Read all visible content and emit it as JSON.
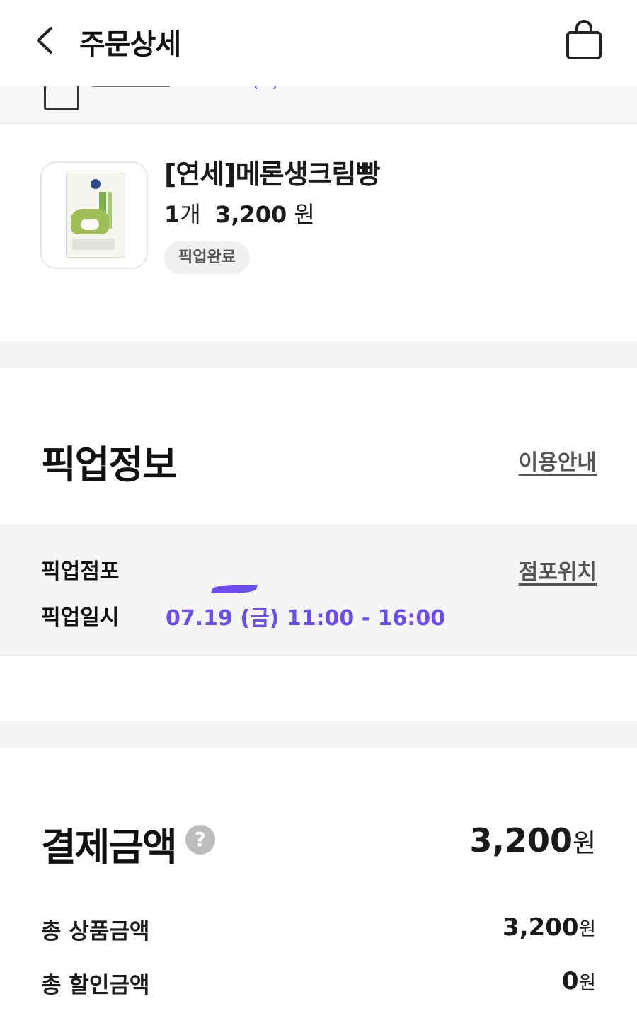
{
  "header": {
    "title": "주문상세",
    "back_icon": "chevron-left-icon",
    "cart_icon": "shopping-bag-icon"
  },
  "order_item": {
    "name": "[연세]메론생크림빵",
    "quantity": "1",
    "quantity_unit": "개",
    "price": "3,200",
    "price_unit": "원",
    "status": "픽업완료"
  },
  "pickup": {
    "title": "픽업정보",
    "guide_link": "이용안내",
    "store_label": "픽업점포",
    "store_location_link": "점포위치",
    "datetime_label": "픽업일시",
    "datetime_value": "07.19 (금)  11:00 - 16:00"
  },
  "payment": {
    "title": "결제금액",
    "help_icon": "question-circle-icon",
    "total": "3,200",
    "unit": "원",
    "rows": [
      {
        "label": "총 상품금액",
        "value": "3,200"
      },
      {
        "label": "총 할인금액",
        "value": "0"
      }
    ]
  },
  "colors": {
    "accent": "#6a4cf0",
    "divider_band": "#f4f4f4"
  }
}
